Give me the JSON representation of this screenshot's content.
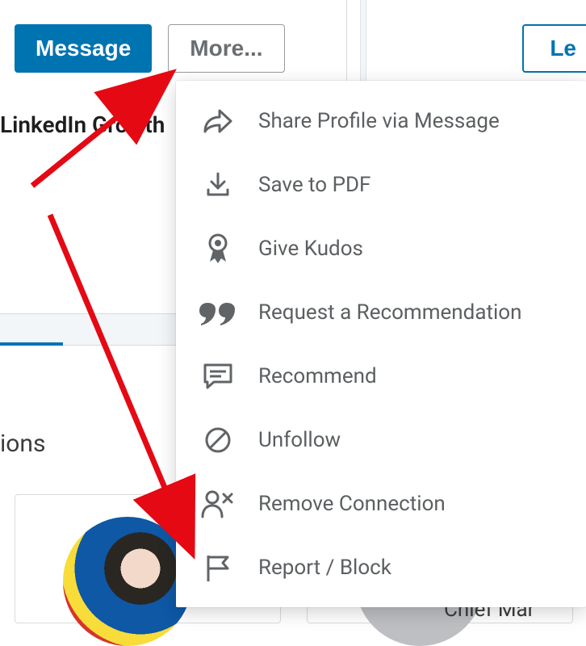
{
  "actions": {
    "message": "Message",
    "more": "More...",
    "learn_fragment": "Le"
  },
  "headline_fragment": "LinkedIn Growth",
  "side_word_fragment": "ions",
  "chief_fragment": "Chief Mar",
  "dropdown": {
    "items": [
      {
        "label": "Share Profile via Message"
      },
      {
        "label": "Save to PDF"
      },
      {
        "label": "Give Kudos"
      },
      {
        "label": "Request a Recommendation"
      },
      {
        "label": "Recommend"
      },
      {
        "label": "Unfollow"
      },
      {
        "label": "Remove Connection"
      },
      {
        "label": "Report / Block"
      }
    ]
  }
}
